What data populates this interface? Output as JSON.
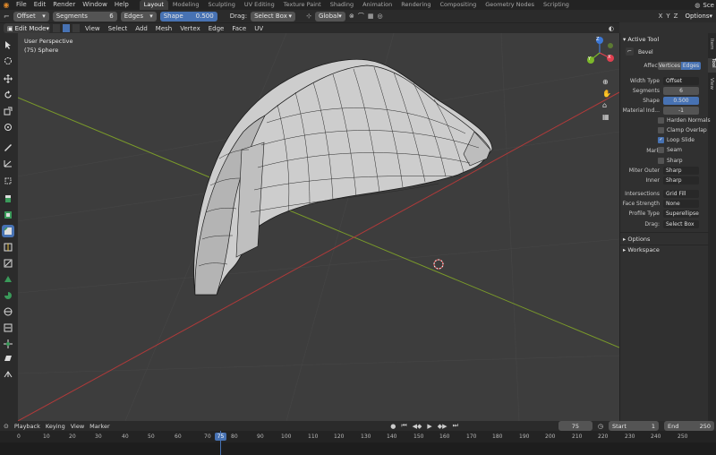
{
  "menubar": {
    "menus": [
      "File",
      "Edit",
      "Render",
      "Window",
      "Help"
    ],
    "workspaces": [
      "Layout",
      "Modeling",
      "Sculpting",
      "UV Editing",
      "Texture Paint",
      "Shading",
      "Animation",
      "Rendering",
      "Compositing",
      "Geometry Nodes",
      "Scripting"
    ],
    "active_workspace": "Layout",
    "scene_label": "Sce"
  },
  "toolheader": {
    "width_type": "Offset",
    "segments_label": "Segments",
    "segments_value": "6",
    "affect": "Edges",
    "shape_label": "Shape",
    "shape_value": "0.500",
    "drag_label": "Drag:",
    "drag_value": "Select Box",
    "orientation": "Global",
    "options_label": "Options"
  },
  "modeheader": {
    "mode": "Edit Mode",
    "menus": [
      "View",
      "Select",
      "Add",
      "Mesh",
      "Vertex",
      "Edge",
      "Face",
      "UV"
    ]
  },
  "viewport": {
    "perspective": "User Perspective",
    "object": "(75) Sphere",
    "axes": {
      "x": "X",
      "y": "Y",
      "z": "Z"
    }
  },
  "npanel": {
    "section_active_tool": "Active Tool",
    "tool_name": "Bevel",
    "affect_label": "Affect",
    "affect_vertices": "Vertices",
    "affect_edges": "Edges",
    "width_type_label": "Width Type",
    "width_type_value": "Offset",
    "segments_label": "Segments",
    "segments_value": "6",
    "shape_label": "Shape",
    "shape_value": "0.500",
    "material_label": "Material Ind...",
    "material_value": "-1",
    "harden_normals": "Harden Normals",
    "clamp_overlap": "Clamp Overlap",
    "loop_slide": "Loop Slide",
    "mark_label": "Mark",
    "seam": "Seam",
    "sharp": "Sharp",
    "miter_outer_label": "Miter Outer",
    "miter_outer_value": "Sharp",
    "inner_label": "Inner",
    "inner_value": "Sharp",
    "intersections_label": "Intersections",
    "intersections_value": "Grid Fill",
    "face_strength_label": "Face Strength",
    "face_strength_value": "None",
    "profile_type_label": "Profile Type",
    "profile_type_value": "Superellipse",
    "drag_label": "Drag:",
    "drag_value": "Select Box",
    "section_options": "Options",
    "section_workspace": "Workspace",
    "tabs": [
      "Item",
      "Tool",
      "View"
    ],
    "loop_slide_checked": true
  },
  "timeline": {
    "menus": [
      "Playback",
      "Keying",
      "View",
      "Marker"
    ],
    "current_frame": "75",
    "start_label": "Start",
    "start_value": "1",
    "end_label": "End",
    "end_value": "250",
    "ticks": [
      "0",
      "10",
      "20",
      "30",
      "40",
      "50",
      "60",
      "70",
      "75",
      "80",
      "90",
      "100",
      "110",
      "120",
      "130",
      "140",
      "150",
      "160",
      "170",
      "180",
      "190",
      "200",
      "210",
      "220",
      "230",
      "240",
      "250"
    ]
  },
  "colors": {
    "accent": "#4772b3",
    "x_axis": "#b03a3a",
    "y_axis": "#7a9a2a",
    "gizmo_x": "#e04050",
    "gizmo_y": "#7cb82a",
    "gizmo_z": "#3d78d6"
  }
}
